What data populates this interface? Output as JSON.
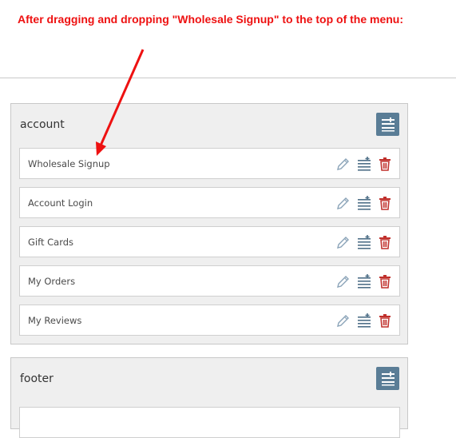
{
  "annotation": {
    "text": "After dragging and dropping \"Wholesale Signup\" to the top of the menu:",
    "color": "#ee1111"
  },
  "menus": [
    {
      "title": "account",
      "items": [
        {
          "label": "Wholesale Signup"
        },
        {
          "label": "Account Login"
        },
        {
          "label": "Gift Cards"
        },
        {
          "label": "My Orders"
        },
        {
          "label": "My Reviews"
        }
      ]
    },
    {
      "title": "footer",
      "items": []
    }
  ],
  "icons": {
    "add": "add-submenu-icon",
    "edit": "pencil-icon",
    "submenu": "submenu-list-icon",
    "delete": "trash-icon"
  },
  "colors": {
    "add_button_bg": "#5a7d96",
    "delete_icon": "#c0302c",
    "edit_icon": "#8aa3b8",
    "submenu_icon": "#4f7088"
  }
}
